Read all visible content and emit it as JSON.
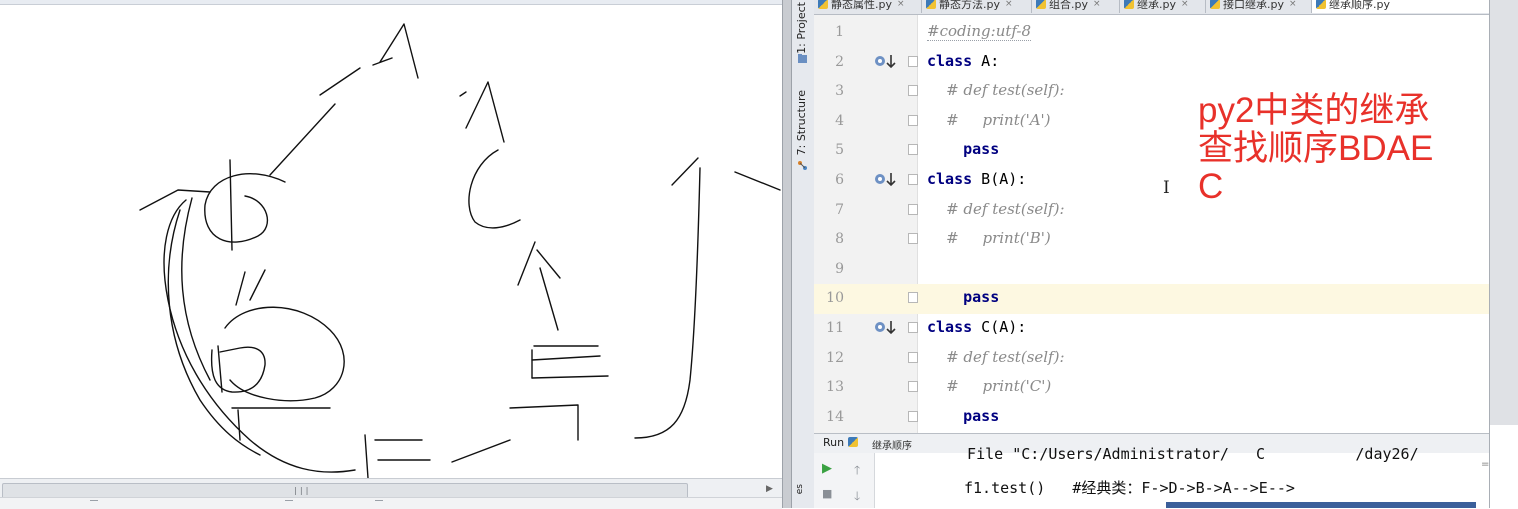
{
  "ide": {
    "tool_windows": {
      "project": "1: Project",
      "structure": "7: Structure"
    },
    "tabs": [
      {
        "label": "静态属性.py"
      },
      {
        "label": "静态方法.py"
      },
      {
        "label": "组合.py"
      },
      {
        "label": "继承.py"
      },
      {
        "label": "接口继承.py"
      },
      {
        "label": "继承顺序.py",
        "active": true
      }
    ],
    "code_lines": [
      {
        "num": "1",
        "text": "#coding:utf-8"
      },
      {
        "num": "2",
        "text": "class A:"
      },
      {
        "num": "3",
        "text": "    # def test(self):"
      },
      {
        "num": "4",
        "text": "    #     print('A')"
      },
      {
        "num": "5",
        "text": "    pass"
      },
      {
        "num": "6",
        "text": "class B(A):"
      },
      {
        "num": "7",
        "text": "    # def test(self):"
      },
      {
        "num": "8",
        "text": "    #     print('B')"
      },
      {
        "num": "9",
        "text": ""
      },
      {
        "num": "10",
        "text": "    pass"
      },
      {
        "num": "11",
        "text": "class C(A):"
      },
      {
        "num": "12",
        "text": "    # def test(self):"
      },
      {
        "num": "13",
        "text": "    #     print('C')"
      },
      {
        "num": "14",
        "text": "    pass"
      }
    ],
    "annotation": "py2中类的继承\n查找顺序BDAE\nC",
    "run": {
      "title": "Run",
      "config_name": "继承顺序",
      "console_cut": "  File \"C:/Users/Administrator/   C          /day26/",
      "console_line": "f1.test()   #经典类：F->D->B->A-->E-->"
    }
  },
  "colors": {
    "annotation": "#e8312a",
    "keyword": "#000080",
    "comment": "#8a8a8a",
    "current_line": "#fdf8e1"
  }
}
